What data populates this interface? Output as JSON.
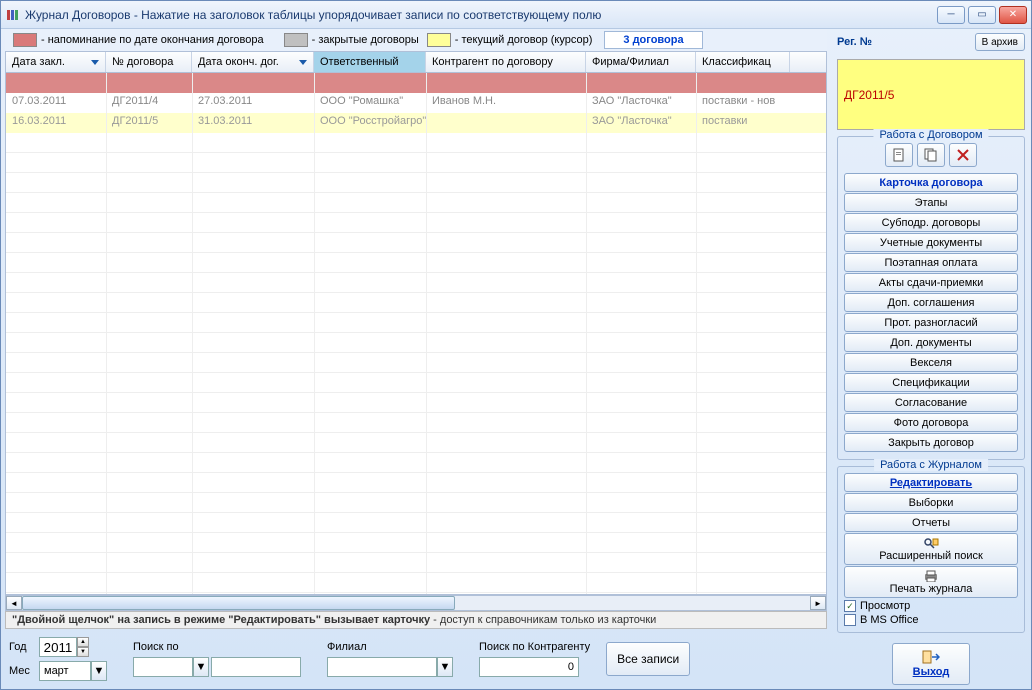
{
  "window": {
    "title": "Журнал Договоров   -   Нажатие на заголовок таблицы упорядочивает записи по соответствующему полю"
  },
  "legend": {
    "reminder": "- напоминание по дате окончания договора",
    "closed": "- закрытые договоры",
    "current": "- текущий договор (курсор)",
    "count": "3 договора",
    "colors": {
      "reminder": "#d97a7a",
      "closed": "#c0c0c0",
      "current": "#ffff99"
    }
  },
  "columns": [
    "Дата закл.",
    "№ договора",
    "Дата оконч. дог.",
    "Ответственный",
    "Контрагент по договору",
    "Фирма/Филиал",
    "Классификац"
  ],
  "rows": [
    {
      "kind": "reminder",
      "cells": [
        "",
        "",
        "",
        "",
        "",
        "",
        ""
      ]
    },
    {
      "kind": "normal",
      "cells": [
        "07.03.2011",
        "ДГ2011/4",
        "27.03.2011",
        "ООО \"Ромашка\"",
        "Иванов М.Н.",
        "ЗАО \"Ласточка\"",
        "поставки - нов"
      ]
    },
    {
      "kind": "current",
      "cells": [
        "16.03.2011",
        "ДГ2011/5",
        "31.03.2011",
        "ООО \"Росстройагро\"",
        "",
        "ЗАО \"Ласточка\"",
        "поставки"
      ]
    }
  ],
  "hint": {
    "bold": "\"Двойной щелчок\" на запись в режиме \"Редактировать\" вызывает карточку",
    "rest": "  -   доступ к справочникам только из карточки"
  },
  "filters": {
    "year_label": "Год",
    "year": "2011",
    "month_label": "Мес",
    "month": "март",
    "search_label": "Поиск по",
    "branch_label": "Филиал",
    "contr_label": "Поиск по Контрагенту",
    "contr_value": "0",
    "all_btn": "Все записи"
  },
  "side": {
    "reg_label": "Рег. №",
    "reg_value": "ДГ2011/5",
    "archive": "В архив",
    "group1_title": "Работа с Договором",
    "group1_buttons": [
      "Карточка договора",
      "Этапы",
      "Субподр. договоры",
      "Учетные документы",
      "Поэтапная оплата",
      "Акты сдачи-приемки",
      "Доп. соглашения",
      "Прот. разногласий",
      "Доп. документы",
      "Векселя",
      "Спецификации",
      "Согласование",
      "Фото договора",
      "Закрыть договор"
    ],
    "group2_title": "Работа с Журналом",
    "edit": "Редактировать",
    "sel": "Выборки",
    "rep": "Отчеты",
    "ext_search": "Расширенный поиск",
    "print": "Печать журнала",
    "preview": "Просмотр",
    "msoffice": "В MS Office",
    "exit": "Выход"
  }
}
